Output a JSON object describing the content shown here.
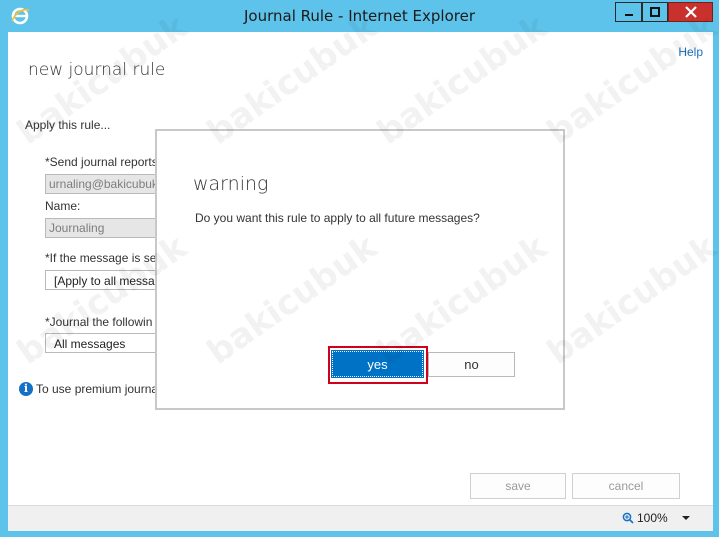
{
  "window": {
    "title": "Journal Rule - Internet Explorer"
  },
  "page": {
    "help": "Help",
    "title": "new journal rule",
    "apply_label": "Apply this rule...",
    "send_reports_label": "*Send journal reports to:",
    "send_reports_value": "urnaling@bakicubuk",
    "name_label": "Name:",
    "name_value": "Journaling",
    "if_label": "*If the message is se",
    "if_value": "[Apply to all messa",
    "journal_label": "*Journal the followin",
    "journal_value": "All messages",
    "info_text": "To use premium journa",
    "save": "save",
    "cancel": "cancel",
    "zoom": "100%"
  },
  "dialog": {
    "title": "warning",
    "message": "Do you want this rule to apply to all future messages?",
    "yes": "yes",
    "no": "no"
  },
  "watermark": "bakicubuk",
  "colors": {
    "titlebar": "#5ec3ea",
    "close": "#c9322c",
    "primary": "#0072c6",
    "highlight": "#d0021b"
  }
}
